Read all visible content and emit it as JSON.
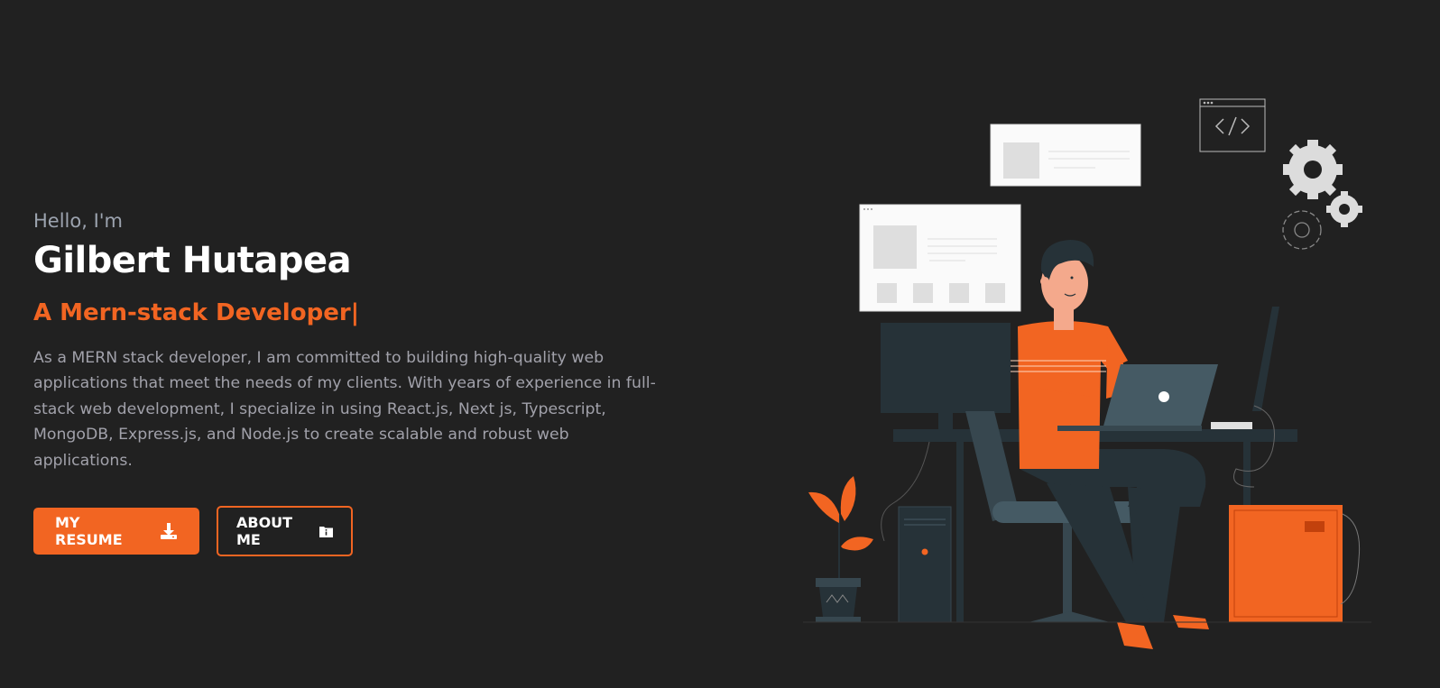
{
  "hero": {
    "greeting": "Hello, I'm",
    "name": "Gilbert Hutapea",
    "role": "A Mern-stack Developer|",
    "bio": "As a MERN stack developer, I am committed to building high-quality web applications that meet the needs of my clients. With years of experience in full-stack web development, I specialize in using React.js, Next js, Typescript, MongoDB, Express.js, and Node.js to create scalable and robust web applications."
  },
  "buttons": {
    "resume_label": "MY RESUME",
    "resume_icon": "download-icon",
    "about_label": "ABOUT ME",
    "about_icon": "info-folder-icon"
  },
  "colors": {
    "background": "#212121",
    "accent": "#f26522",
    "text_primary": "#ffffff",
    "text_muted": "#a1a1aa"
  },
  "illustration": {
    "icon": "developer-at-desk-illustration"
  }
}
